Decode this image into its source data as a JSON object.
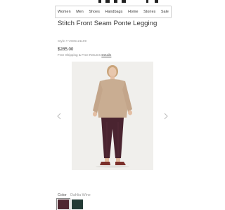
{
  "nav": {
    "items": [
      "Women",
      "Men",
      "Shoes",
      "Handbags",
      "Home",
      "Stories",
      "Sale"
    ]
  },
  "product": {
    "title": "Stitch Front Seam Ponte Legging",
    "style_code": "Style # V606121199",
    "price": "$285.00",
    "shipping_text": "Free Shipping & Free Returns",
    "details_link": "Details"
  },
  "gallery": {
    "prev_icon": "chevron-left-icon",
    "next_icon": "chevron-right-icon"
  },
  "color": {
    "label": "Color",
    "selected": "Dahlia Wine",
    "swatches": [
      {
        "name": "dahlia-wine",
        "hex": "#4e2630",
        "selected": true
      },
      {
        "name": "dark-green",
        "hex": "#233a35",
        "selected": false
      }
    ]
  }
}
